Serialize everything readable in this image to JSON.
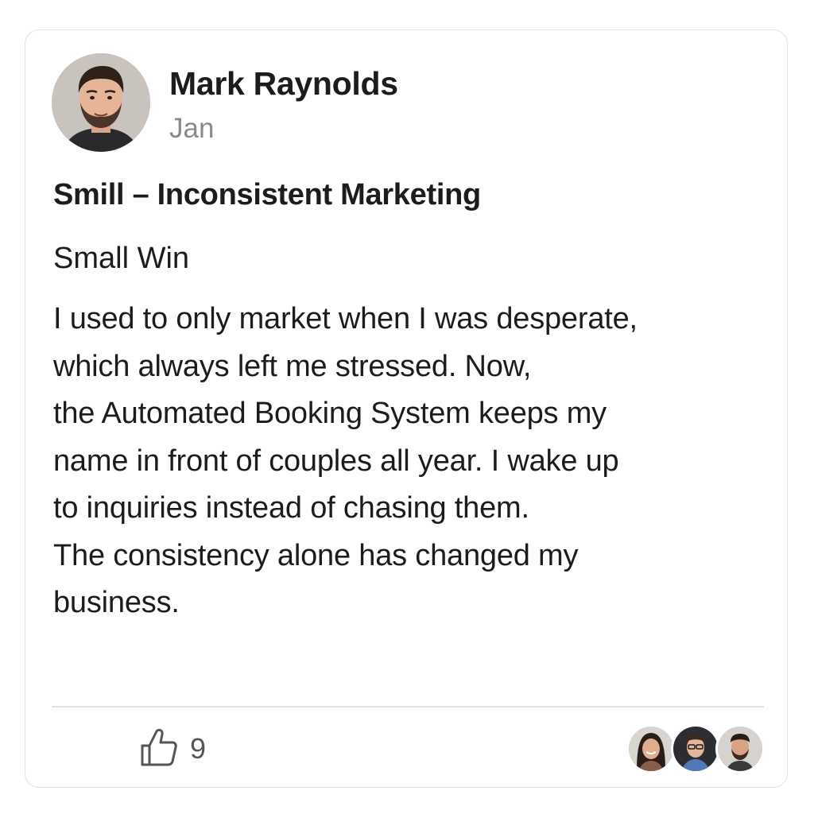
{
  "post": {
    "author": {
      "name": "Mark Raynolds",
      "avatar_icon": "user-avatar"
    },
    "date": "Jan",
    "title": "Smill – Inconsistent Marketing",
    "subtitle": "Small Win",
    "body_lines": [
      "I used to only market when I was desperate,",
      "which always left me stressed. Now,",
      "the Automated Booking System keeps my",
      "name in front of couples all year. I wake up",
      "to inquiries instead of chasing them.",
      "The consistency alone has changed my",
      "business."
    ]
  },
  "footer": {
    "like_icon": "thumbs-up-icon",
    "like_count": "9",
    "reactors": [
      {
        "avatar_icon": "reactor-avatar-woman"
      },
      {
        "avatar_icon": "reactor-avatar-man-glasses"
      },
      {
        "avatar_icon": "reactor-avatar-man-beard"
      }
    ]
  },
  "colors": {
    "text_primary": "#1c1c1e",
    "text_secondary": "#8a8a8e",
    "border": "#e3e3e6",
    "background": "#ffffff"
  }
}
